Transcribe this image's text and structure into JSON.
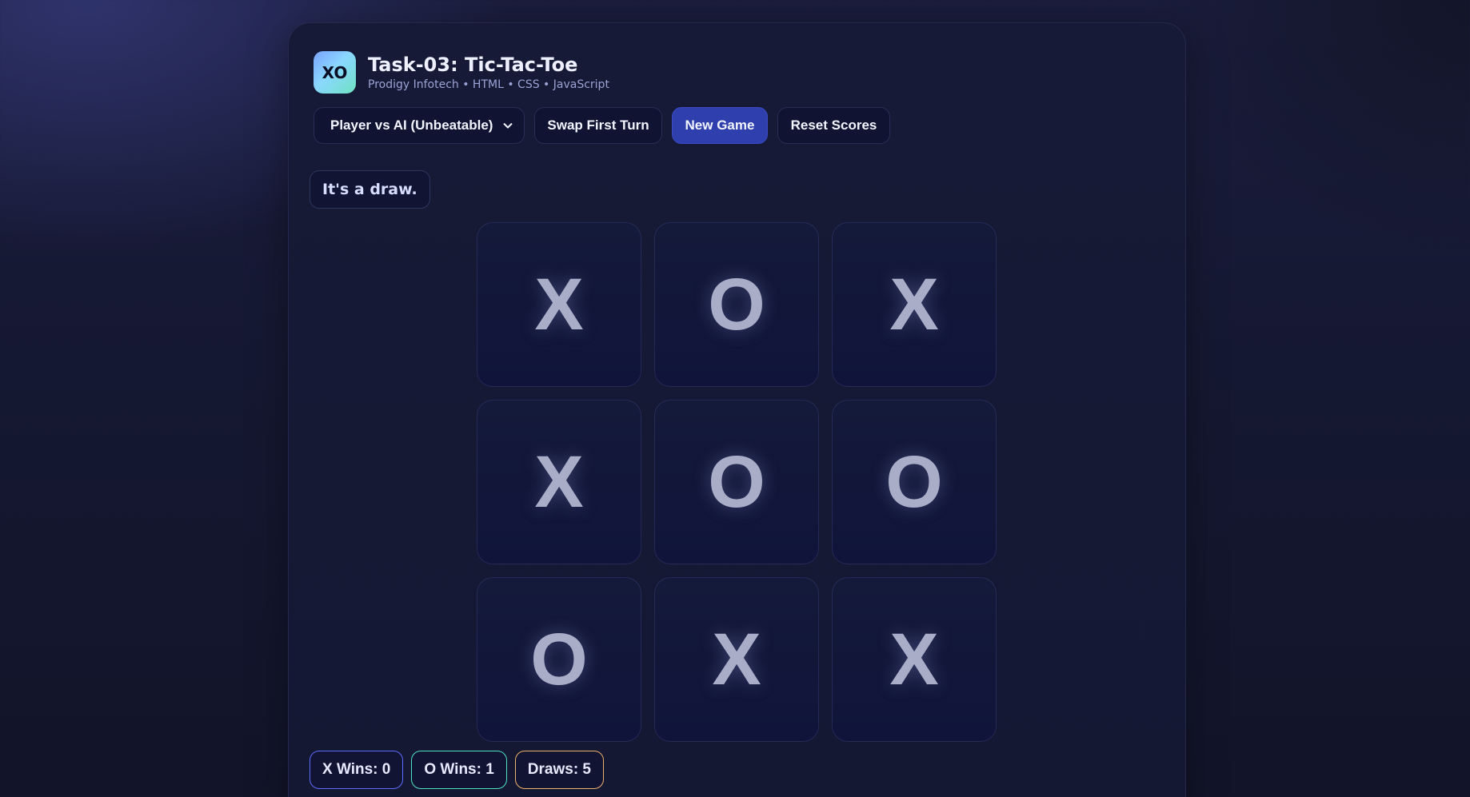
{
  "header": {
    "logo_text": "XO",
    "title": "Task-03: Tic-Tac-Toe",
    "subtitle": "Prodigy Infotech • HTML • CSS • JavaScript"
  },
  "controls": {
    "mode_selected": "Player vs AI (Unbeatable)",
    "swap_label": "Swap First Turn",
    "new_game_label": "New Game",
    "reset_label": "Reset Scores"
  },
  "status": "It's a draw.",
  "board": {
    "cells": [
      "X",
      "O",
      "X",
      "X",
      "O",
      "O",
      "O",
      "X",
      "X"
    ]
  },
  "scores": {
    "x": "X Wins: 0",
    "o": "O Wins: 1",
    "draws": "Draws: 5"
  },
  "colors": {
    "x_score_border": "#5d6bff",
    "o_score_border": "#4fe0c0",
    "draw_score_border": "#f0b06a",
    "primary_button": "#2f3fae"
  }
}
